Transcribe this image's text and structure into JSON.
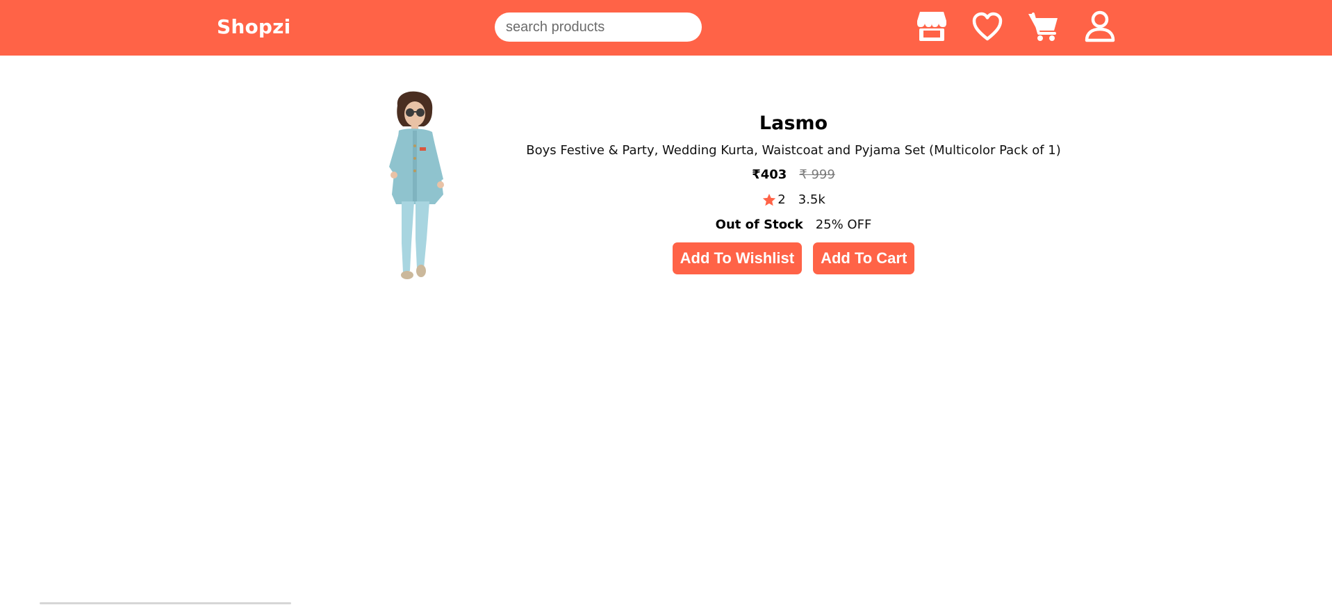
{
  "header": {
    "brand": "Shopzi",
    "search_placeholder": "search products",
    "icons": [
      "store-icon",
      "heart-icon",
      "cart-icon",
      "user-icon"
    ],
    "background_color": "#ff6347"
  },
  "product": {
    "name": "Lasmo",
    "description": "Boys Festive & Party, Wedding Kurta, Waistcoat and Pyjama Set (Multicolor Pack of 1)",
    "price": "₹403",
    "original_price": "₹ 999",
    "rating": "2",
    "reviews": "3.5k",
    "stock_status": "Out of Stock",
    "discount": "25% OFF",
    "image": "boy-kurta-pyjama-photo"
  },
  "actions": {
    "wishlist_label": "Add To Wishlist",
    "cart_label": "Add To Cart"
  },
  "colors": {
    "accent": "#ff6347",
    "strikethrough": "#7a7a7a"
  }
}
